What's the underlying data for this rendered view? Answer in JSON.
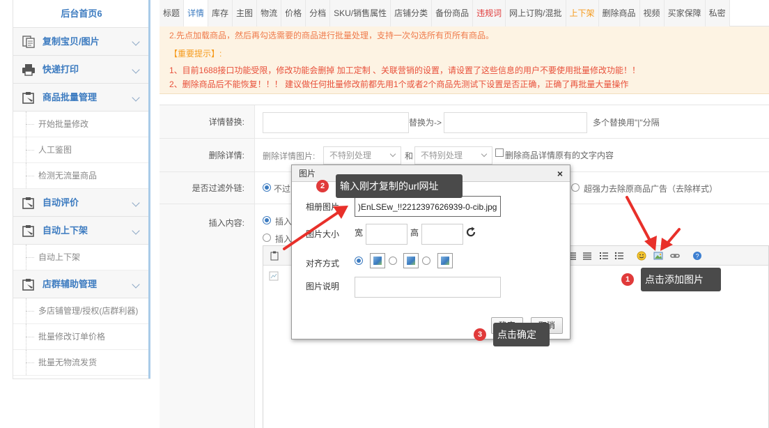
{
  "sidebar": {
    "home": "后台首页6",
    "groups": [
      {
        "label": "复制宝贝/图片",
        "icon": "copy-document-icon"
      },
      {
        "label": "快递打印",
        "icon": "printer-icon"
      },
      {
        "label": "商品批量管理",
        "icon": "clipboard-icon"
      },
      {
        "label": "自动评价",
        "icon": "clipboard-icon"
      },
      {
        "label": "自动上下架",
        "icon": "clipboard-icon"
      },
      {
        "label": "店群辅助管理",
        "icon": "clipboard-icon"
      }
    ],
    "batch_items": [
      "开始批量修改",
      "人工鉴图",
      "检测无流量商品"
    ],
    "shelf_items": [
      "自动上下架"
    ],
    "group_items": [
      "多店铺管理/授权(店群利器)",
      "批量修改订单价格",
      "批量无物流发货"
    ]
  },
  "tabs": [
    {
      "label": "标题"
    },
    {
      "label": "详情"
    },
    {
      "label": "库存"
    },
    {
      "label": "主图"
    },
    {
      "label": "物流"
    },
    {
      "label": "价格"
    },
    {
      "label": "分档"
    },
    {
      "label": "SKU/销售属性"
    },
    {
      "label": "店铺分类"
    },
    {
      "label": "备份商品"
    },
    {
      "label": "违规词"
    },
    {
      "label": "网上订购/混批"
    },
    {
      "label": "上下架"
    },
    {
      "label": "删除商品"
    },
    {
      "label": "视频"
    },
    {
      "label": "买家保障"
    },
    {
      "label": "私密"
    }
  ],
  "notice": {
    "line0": "2.先点加载商品，然后再勾选需要的商品进行批量处理，支持一次勾选所有页所有商品。",
    "heading": "【重要提示】:",
    "line1": "1、目前1688接口功能受限，修改功能会删掉 加工定制 、关联营销的设置，请设置了这些信息的用户不要使用批量修改功能！！",
    "line2": "2、删除商品后不能恢复！！！ 建议做任何批量修改前都先用1个或者2个商品先测试下设置是否正确，正确了再批量大量操作"
  },
  "form": {
    "replace_label": "详情替换:",
    "replace_to": "替换为->",
    "replace_hint": "多个替换用\"|\"分隔",
    "delete_label": "删除详情:",
    "delete_images_label": "删除详情图片:",
    "select_value_1": "不特别处理",
    "and_text": "和",
    "select_value_2": "不特别处理",
    "delete_text_checkbox": "删除商品详情原有的文字内容",
    "filter_label": "是否过滤外链:",
    "filter_option_1": "不过",
    "filter_option_strong": "超强力去除原商品广告（去除样式）",
    "insert_label": "插入内容:",
    "insert_option_1": "插入",
    "insert_option_2": "插入"
  },
  "dialog": {
    "title": "图片",
    "close": "×",
    "album_label": "相册图片",
    "album_value": ")EnLSEw_!!2212397626939-0-cib.jpg",
    "size_label": "图片大小",
    "width_label": "宽",
    "height_label": "高",
    "align_label": "对齐方式",
    "desc_label": "图片说明",
    "ok": "确定",
    "cancel": "取消"
  },
  "annotations": {
    "step1": {
      "badge": "1",
      "text": "点击添加图片"
    },
    "step2": {
      "badge": "2",
      "text": "输入刚才复制的url网址"
    },
    "step3": {
      "badge": "3",
      "text": "点击确定"
    }
  },
  "colors": {
    "accent": "#3c7bc0",
    "danger": "#e03a3a",
    "warning": "#f59b1d",
    "notice_bg": "#fdf3e3"
  }
}
